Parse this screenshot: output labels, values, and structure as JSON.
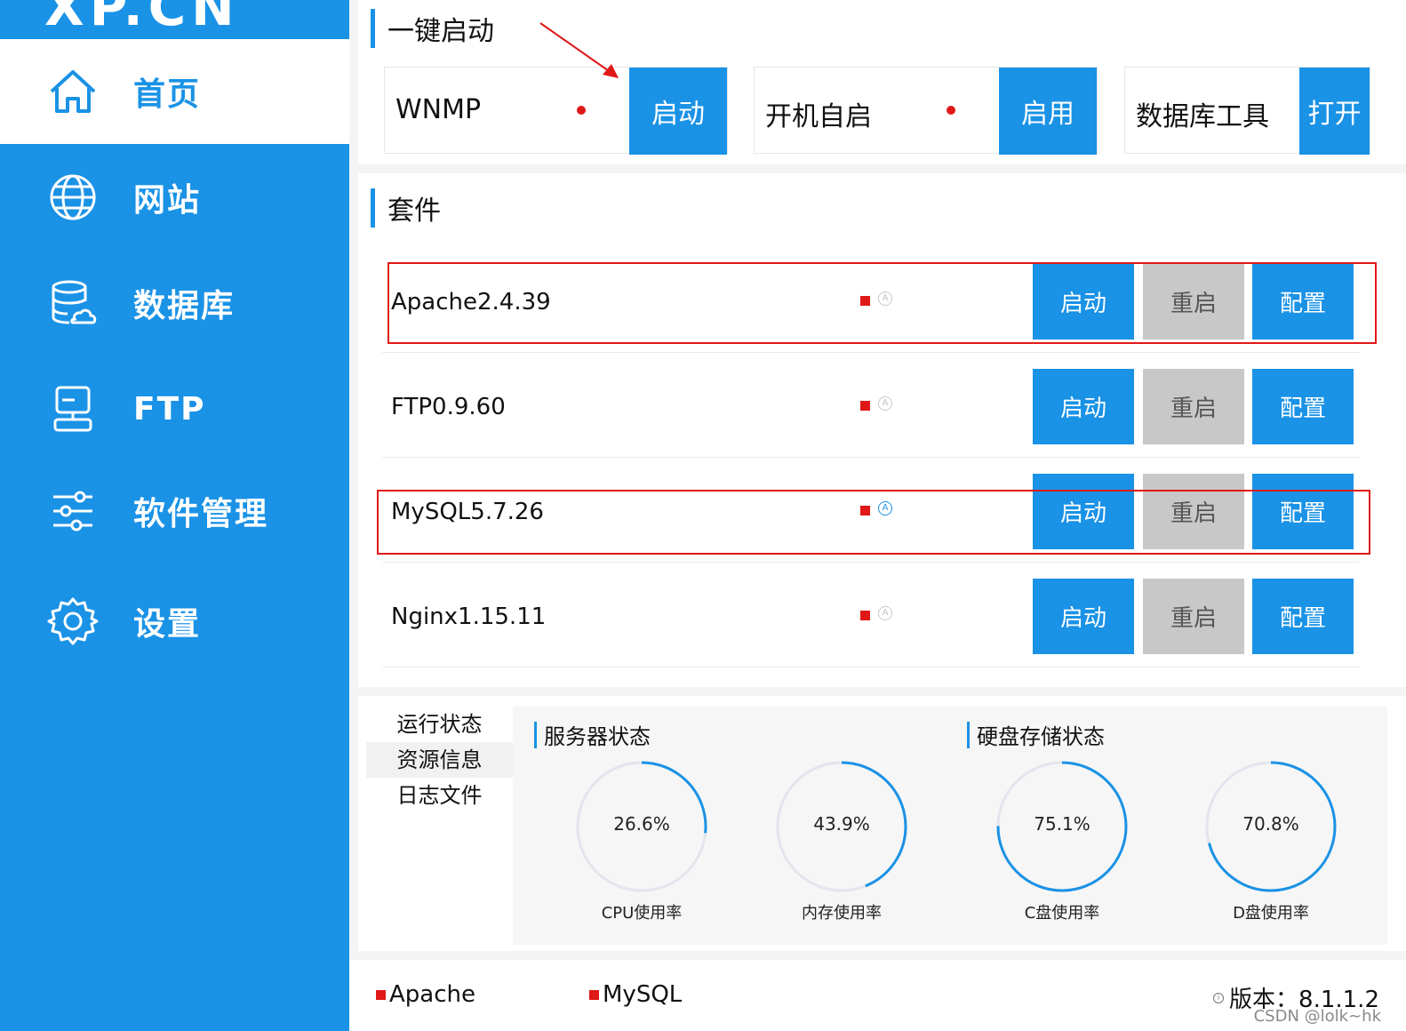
{
  "logo": {
    "text": "XP.CN"
  },
  "sidebar": {
    "items": [
      {
        "label": "首页",
        "icon": "home-icon",
        "active": true
      },
      {
        "label": "网站",
        "icon": "globe-icon"
      },
      {
        "label": "数据库",
        "icon": "database-icon"
      },
      {
        "label": "FTP",
        "icon": "server-icon"
      },
      {
        "label": "软件管理",
        "icon": "sliders-icon"
      },
      {
        "label": "设置",
        "icon": "gear-icon"
      }
    ]
  },
  "quick_start": {
    "title": "一键启动",
    "cards": [
      {
        "label": "WNMP",
        "button": "启动",
        "status": "stopped"
      },
      {
        "label": "开机自启",
        "button": "启用",
        "status": "disabled"
      },
      {
        "label": "数据库工具",
        "button": "打开"
      }
    ]
  },
  "suite": {
    "title": "套件",
    "rows": [
      {
        "name": "Apache2.4.39",
        "auto_start": false,
        "auto_glyph": "A",
        "start": "启动",
        "restart": "重启",
        "config": "配置"
      },
      {
        "name": "FTP0.9.60",
        "auto_start": false,
        "auto_glyph": "A",
        "start": "启动",
        "restart": "重启",
        "config": "配置"
      },
      {
        "name": "MySQL5.7.26",
        "auto_start": true,
        "auto_glyph": "A",
        "start": "启动",
        "restart": "重启",
        "config": "配置"
      },
      {
        "name": "Nginx1.15.11",
        "auto_start": false,
        "auto_glyph": "A",
        "start": "启动",
        "restart": "重启",
        "config": "配置"
      }
    ]
  },
  "status_tabs": [
    "运行状态",
    "资源信息",
    "日志文件"
  ],
  "server_status": {
    "title": "服务器状态",
    "gauges": [
      {
        "value_text": "26.6%",
        "value": 26.6,
        "label": "CPU使用率"
      },
      {
        "value_text": "43.9%",
        "value": 43.9,
        "label": "内存使用率"
      }
    ]
  },
  "disk_status": {
    "title": "硬盘存储状态",
    "gauges": [
      {
        "value_text": "75.1%",
        "value": 75.1,
        "label": "C盘使用率"
      },
      {
        "value_text": "70.8%",
        "value": 70.8,
        "label": "D盘使用率"
      }
    ]
  },
  "footer": {
    "services": [
      "Apache",
      "MySQL"
    ],
    "version_label": "版本：8.1.1.2",
    "info_glyph": "i",
    "watermark": "CSDN @lolk~hk"
  },
  "colors": {
    "accent": "#1a92e6",
    "danger": "#e01818",
    "gray_button": "#c8c8c8",
    "track": "#e4e4ee"
  }
}
